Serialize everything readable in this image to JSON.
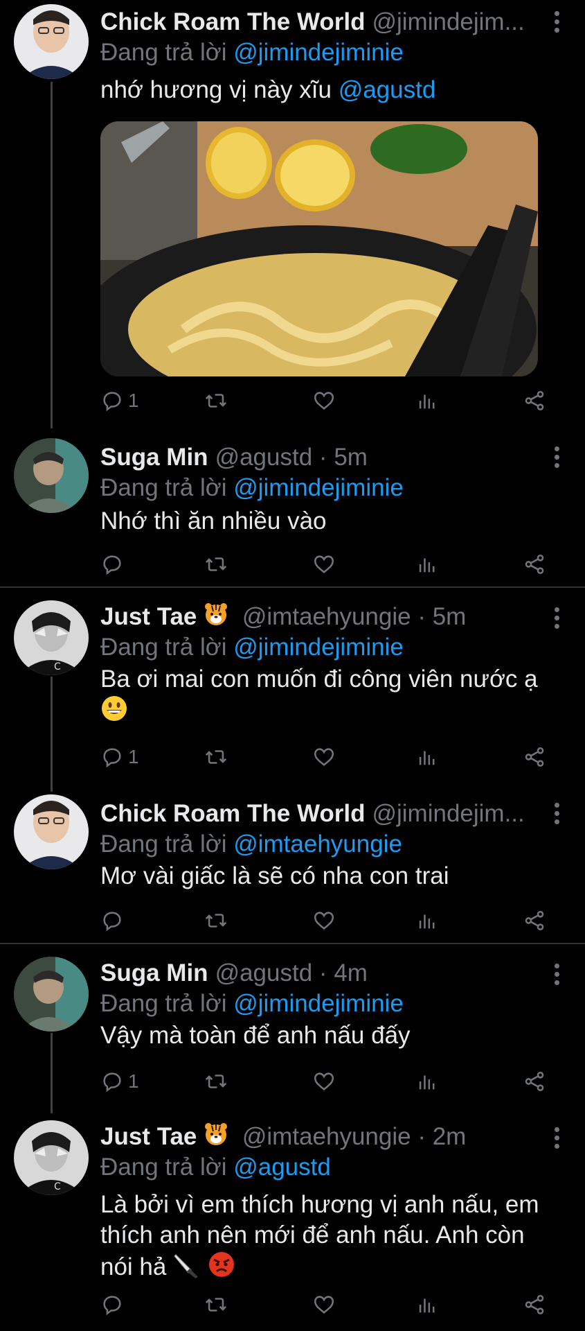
{
  "replying_label": "Đang trả lời",
  "tweets": [
    {
      "name": "Chick Roam The World",
      "handle": "@jimindejim...",
      "time": "",
      "replying_to": "@jimindejiminie",
      "text_plain": "nhớ hương vị này xĩu",
      "text_mention": "@agustd",
      "reply_count": "1"
    },
    {
      "name": "Suga Min",
      "handle": "@agustd",
      "time": "5m",
      "replying_to": "@jimindejiminie",
      "text_plain": "Nhớ thì ăn nhiều vào",
      "reply_count": ""
    },
    {
      "name": "Just Tae",
      "name_emoji": "tiger-face",
      "handle": "@imtaehyungie",
      "time": "5m",
      "replying_to": "@jimindejiminie",
      "text_plain": "Ba ơi mai con muốn đi công viên nước ạ",
      "text_emoji": "grinning-face",
      "reply_count": "1"
    },
    {
      "name": "Chick Roam The World",
      "handle": "@jimindejim...",
      "time": "",
      "replying_to": "@imtaehyungie",
      "text_plain": "Mơ vài giấc là sẽ có nha con trai",
      "reply_count": ""
    },
    {
      "name": "Suga Min",
      "handle": "@agustd",
      "time": "4m",
      "replying_to": "@jimindejiminie",
      "text_plain": "Vậy mà toàn để anh nấu đấy",
      "reply_count": "1"
    },
    {
      "name": "Just Tae",
      "name_emoji": "tiger-face",
      "handle": "@imtaehyungie",
      "time": "2m",
      "replying_to": "@agustd",
      "text_line1": "Là bởi vì em thích hương vị anh nấu, em",
      "text_line2": "thích anh nên mới để anh nấu. Anh còn",
      "text_line3": "nói hả",
      "text_emoji": "knife, angry-face",
      "reply_count": ""
    }
  ],
  "separator": "·",
  "colors": {
    "background": "#000000",
    "text": "#e7e9ea",
    "secondary": "#71767b",
    "link": "#1d9bf0",
    "divider": "#2f3336"
  }
}
